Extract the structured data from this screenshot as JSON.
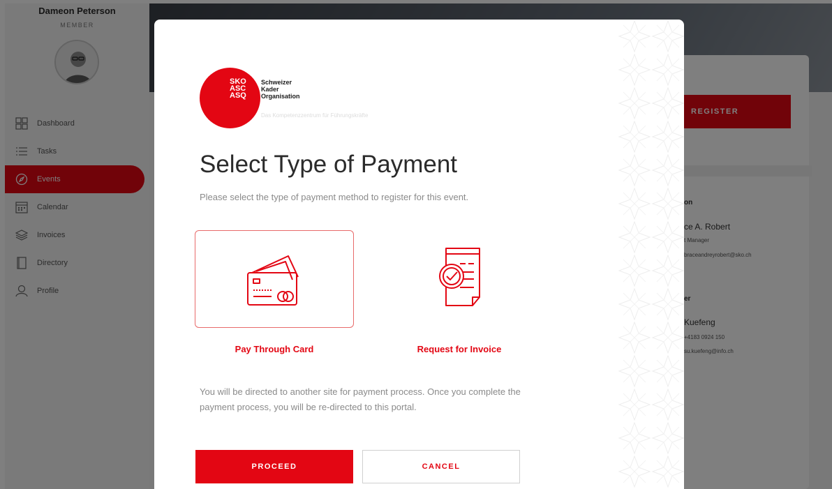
{
  "user": {
    "name": "Dameon Peterson",
    "role": "MEMBER"
  },
  "nav": [
    {
      "label": "Dashboard",
      "icon": "dashboard-icon"
    },
    {
      "label": "Tasks",
      "icon": "tasks-icon"
    },
    {
      "label": "Events",
      "icon": "compass-icon",
      "active": true
    },
    {
      "label": "Calendar",
      "icon": "calendar-icon"
    },
    {
      "label": "Invoices",
      "icon": "layers-icon"
    },
    {
      "label": "Directory",
      "icon": "book-icon"
    },
    {
      "label": "Profile",
      "icon": "person-icon"
    }
  ],
  "event_panel": {
    "register_label": "REGISTER",
    "contact_heading": "on",
    "contact_name": "ce A. Robert",
    "contact_role": "t Manager",
    "contact_email": "braceandreyrobert@sko.ch",
    "organizer_heading": "er",
    "organizer_name": "Kuefeng",
    "organizer_phone": "+4183 0924 150",
    "organizer_email": "su.kuefeng@info.ch"
  },
  "modal": {
    "logo": {
      "mark_lines": [
        "SKO",
        "ASC",
        "ASQ"
      ],
      "name_lines": [
        "Schweizer",
        "Kader",
        "Organisation"
      ],
      "tagline": "Das Kompetenzzentrum für Führungskräfte"
    },
    "title": "Select Type of Payment",
    "subtitle": "Please select the type of payment method to register for this event.",
    "options": [
      {
        "label": "Pay Through Card",
        "icon": "credit-card-icon",
        "selected": true
      },
      {
        "label": "Request for Invoice",
        "icon": "invoice-check-icon",
        "selected": false
      }
    ],
    "note": "You will be directed to another site for payment process. Once you complete the payment process, you will be re-directed to this portal.",
    "proceed_label": "PROCEED",
    "cancel_label": "CANCEL"
  },
  "colors": {
    "accent": "#e30613",
    "overlay": "rgba(0,0,0,0.5)"
  }
}
